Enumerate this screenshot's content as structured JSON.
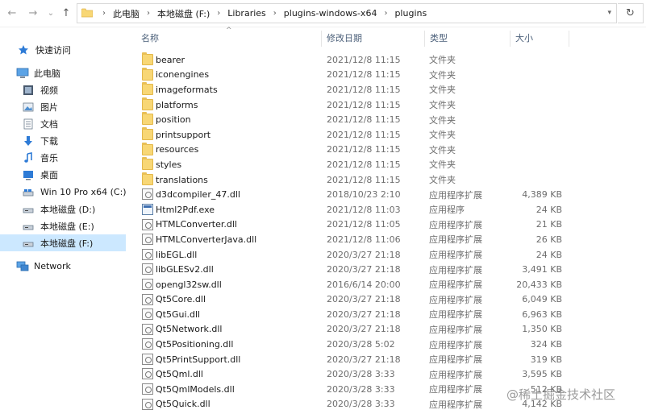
{
  "address": {
    "crumbs": [
      "此电脑",
      "本地磁盘 (F:)",
      "Libraries",
      "plugins-windows-x64",
      "plugins"
    ]
  },
  "nav": {
    "back": "←",
    "forward": "→",
    "dropdown": "⌄",
    "up": "↑",
    "refresh": "↻"
  },
  "sidebar": {
    "items": [
      {
        "label": "快速访问",
        "icon": "star-icon"
      },
      {
        "label": "此电脑",
        "icon": "computer-icon"
      },
      {
        "label": "视频",
        "icon": "video-icon"
      },
      {
        "label": "图片",
        "icon": "picture-icon"
      },
      {
        "label": "文档",
        "icon": "document-icon"
      },
      {
        "label": "下载",
        "icon": "download-icon"
      },
      {
        "label": "音乐",
        "icon": "music-icon"
      },
      {
        "label": "桌面",
        "icon": "desktop-icon"
      },
      {
        "label": "Win 10 Pro x64 (C:)",
        "icon": "drive-icon"
      },
      {
        "label": "本地磁盘 (D:)",
        "icon": "drive-icon"
      },
      {
        "label": "本地磁盘 (E:)",
        "icon": "drive-icon"
      },
      {
        "label": "本地磁盘 (F:)",
        "icon": "drive-icon"
      },
      {
        "label": "Network",
        "icon": "network-icon"
      }
    ]
  },
  "columns": {
    "name": "名称",
    "date": "修改日期",
    "type": "类型",
    "size": "大小"
  },
  "files": [
    {
      "name": "bearer",
      "date": "2021/12/8 11:15",
      "type": "文件夹",
      "size": "",
      "kind": "folder"
    },
    {
      "name": "iconengines",
      "date": "2021/12/8 11:15",
      "type": "文件夹",
      "size": "",
      "kind": "folder"
    },
    {
      "name": "imageformats",
      "date": "2021/12/8 11:15",
      "type": "文件夹",
      "size": "",
      "kind": "folder"
    },
    {
      "name": "platforms",
      "date": "2021/12/8 11:15",
      "type": "文件夹",
      "size": "",
      "kind": "folder"
    },
    {
      "name": "position",
      "date": "2021/12/8 11:15",
      "type": "文件夹",
      "size": "",
      "kind": "folder"
    },
    {
      "name": "printsupport",
      "date": "2021/12/8 11:15",
      "type": "文件夹",
      "size": "",
      "kind": "folder"
    },
    {
      "name": "resources",
      "date": "2021/12/8 11:15",
      "type": "文件夹",
      "size": "",
      "kind": "folder"
    },
    {
      "name": "styles",
      "date": "2021/12/8 11:15",
      "type": "文件夹",
      "size": "",
      "kind": "folder"
    },
    {
      "name": "translations",
      "date": "2021/12/8 11:15",
      "type": "文件夹",
      "size": "",
      "kind": "folder"
    },
    {
      "name": "d3dcompiler_47.dll",
      "date": "2018/10/23 2:10",
      "type": "应用程序扩展",
      "size": "4,389 KB",
      "kind": "dll"
    },
    {
      "name": "Html2Pdf.exe",
      "date": "2021/12/8 11:03",
      "type": "应用程序",
      "size": "24 KB",
      "kind": "exe"
    },
    {
      "name": "HTMLConverter.dll",
      "date": "2021/12/8 11:05",
      "type": "应用程序扩展",
      "size": "21 KB",
      "kind": "dll"
    },
    {
      "name": "HTMLConverterJava.dll",
      "date": "2021/12/8 11:06",
      "type": "应用程序扩展",
      "size": "26 KB",
      "kind": "dll"
    },
    {
      "name": "libEGL.dll",
      "date": "2020/3/27 21:18",
      "type": "应用程序扩展",
      "size": "24 KB",
      "kind": "dll"
    },
    {
      "name": "libGLESv2.dll",
      "date": "2020/3/27 21:18",
      "type": "应用程序扩展",
      "size": "3,491 KB",
      "kind": "dll"
    },
    {
      "name": "opengl32sw.dll",
      "date": "2016/6/14 20:00",
      "type": "应用程序扩展",
      "size": "20,433 KB",
      "kind": "dll"
    },
    {
      "name": "Qt5Core.dll",
      "date": "2020/3/27 21:18",
      "type": "应用程序扩展",
      "size": "6,049 KB",
      "kind": "dll"
    },
    {
      "name": "Qt5Gui.dll",
      "date": "2020/3/27 21:18",
      "type": "应用程序扩展",
      "size": "6,963 KB",
      "kind": "dll"
    },
    {
      "name": "Qt5Network.dll",
      "date": "2020/3/27 21:18",
      "type": "应用程序扩展",
      "size": "1,350 KB",
      "kind": "dll"
    },
    {
      "name": "Qt5Positioning.dll",
      "date": "2020/3/28 5:02",
      "type": "应用程序扩展",
      "size": "324 KB",
      "kind": "dll"
    },
    {
      "name": "Qt5PrintSupport.dll",
      "date": "2020/3/27 21:18",
      "type": "应用程序扩展",
      "size": "319 KB",
      "kind": "dll"
    },
    {
      "name": "Qt5Qml.dll",
      "date": "2020/3/28 3:33",
      "type": "应用程序扩展",
      "size": "3,595 KB",
      "kind": "dll"
    },
    {
      "name": "Qt5QmlModels.dll",
      "date": "2020/3/28 3:33",
      "type": "应用程序扩展",
      "size": "512 KB",
      "kind": "dll"
    },
    {
      "name": "Qt5Quick.dll",
      "date": "2020/3/28 3:33",
      "type": "应用程序扩展",
      "size": "4,142 KB",
      "kind": "dll"
    }
  ],
  "watermark": "@稀土掘金技术社区"
}
